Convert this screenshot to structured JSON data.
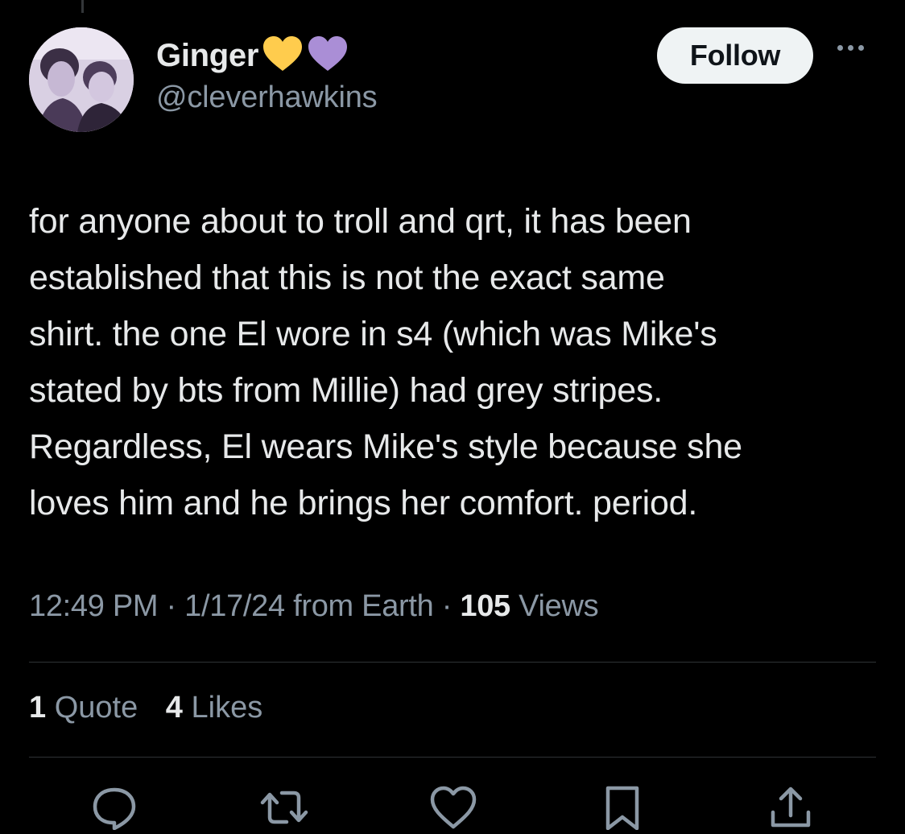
{
  "author": {
    "display_name": "Ginger",
    "handle": "@cleverhawkins",
    "badges": [
      "yellow-heart-icon",
      "purple-heart-icon"
    ]
  },
  "follow_label": "Follow",
  "tweet": {
    "text": "for anyone about to troll and qrt, it has been\nestablished that this is not the exact same\nshirt. the one El wore in s4 (which was Mike's\nstated by bts from Millie) had grey stripes.\nRegardless, El wears Mike's style because she\nloves him and he brings her comfort. period."
  },
  "meta": {
    "time": "12:49 PM",
    "date": "1/17/24",
    "source": "from Earth",
    "separator": "·",
    "views_count": "105",
    "views_label": "Views"
  },
  "stats": {
    "quotes_count": "1",
    "quotes_label": "Quote",
    "likes_count": "4",
    "likes_label": "Likes"
  },
  "actions": [
    "reply-icon",
    "retweet-icon",
    "like-icon",
    "bookmark-icon",
    "share-icon"
  ],
  "colors": {
    "background": "#000000",
    "text": "#e7e9ea",
    "secondary": "#8b98a5",
    "divider": "#2f3336",
    "follow_bg": "#eff3f4",
    "heart_yellow": "#ffcc4d",
    "heart_purple": "#aa8ed6"
  }
}
